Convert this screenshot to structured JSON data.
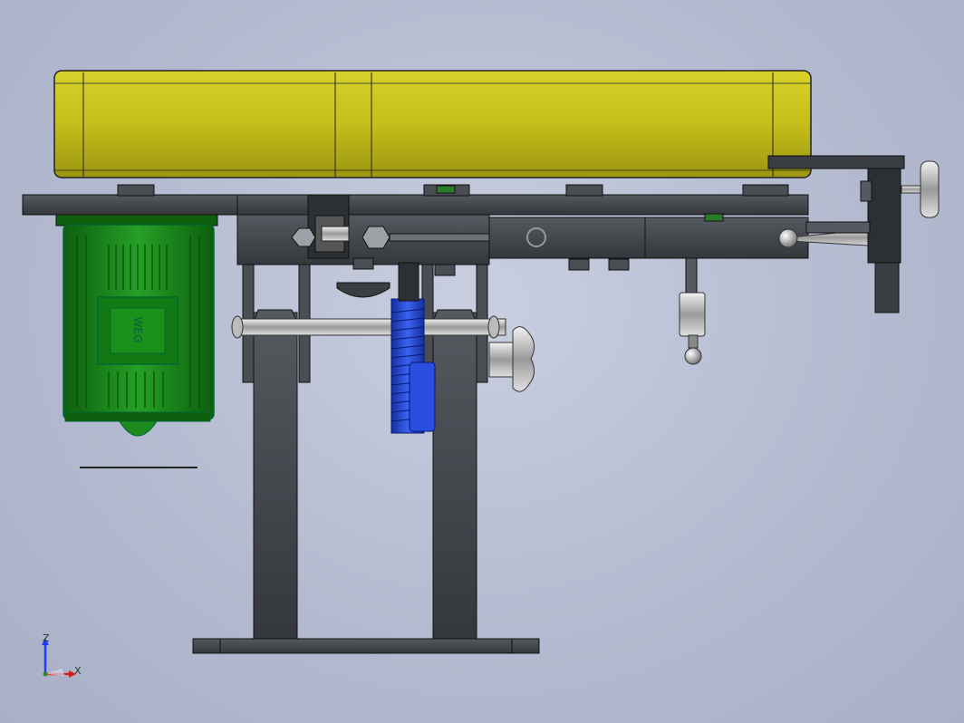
{
  "viewport": {
    "background_top": "#c9cfe0",
    "background_bottom": "#a9b0c6"
  },
  "model": {
    "colors": {
      "belt_guard": "#c9c21e",
      "motor": "#1d8a1d",
      "frame": "#3a3d42",
      "worm_gear": "#1e40c8",
      "handwheel": "#d8d8d8"
    },
    "motor_badge_text": "WEG"
  },
  "triad": {
    "axis_z": "Z",
    "axis_x": "X"
  }
}
